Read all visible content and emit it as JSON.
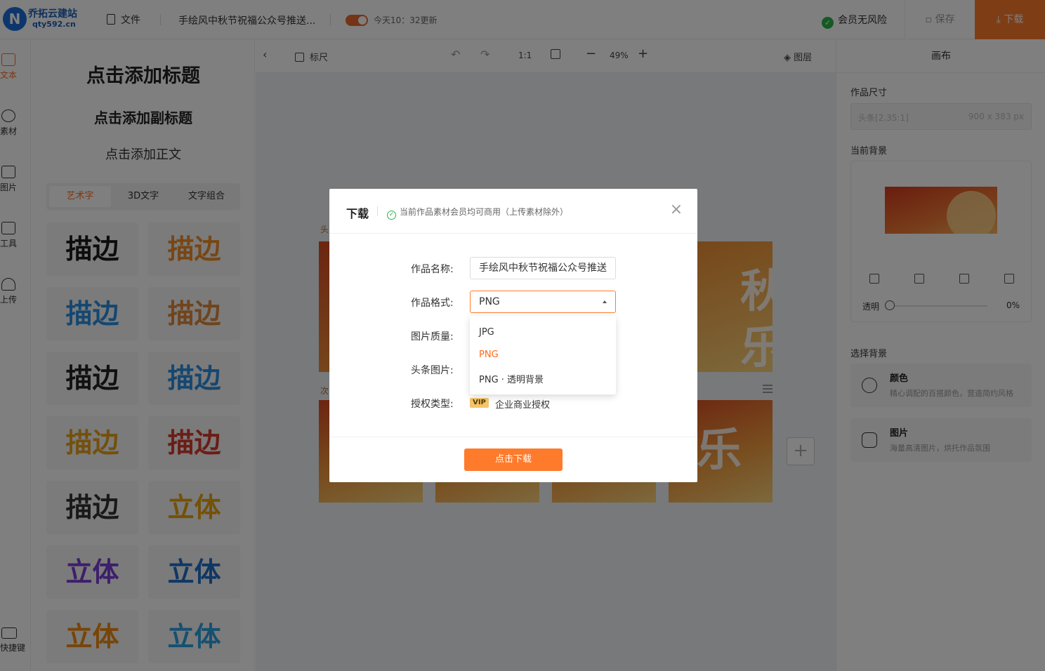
{
  "topbar": {
    "brand_name": "乔拓云建站",
    "brand_domain": "qty592.cn",
    "logo_letter": "N",
    "file_menu": "文件",
    "doc_title": "手绘风中秋节祝福公众号推送...",
    "update_status": "今天10：32更新",
    "vip_status": "会员无风险",
    "save_label": "保存",
    "download_label": "下载"
  },
  "rail": {
    "items": [
      {
        "label": "文本",
        "icon": "text-icon"
      },
      {
        "label": "素材",
        "icon": "material-icon"
      },
      {
        "label": "图片",
        "icon": "image-icon"
      },
      {
        "label": "工具",
        "icon": "toolbox-icon"
      },
      {
        "label": "上传",
        "icon": "upload-cloud-icon"
      }
    ],
    "shortcut_label": "快捷键"
  },
  "textpanel": {
    "add_title": "点击添加标题",
    "add_subtitle": "点击添加副标题",
    "add_body": "点击添加正文",
    "tabs": [
      "艺术字",
      "3D文字",
      "文字组合"
    ],
    "tiles": [
      "描边",
      "描边",
      "描边",
      "描边",
      "描边",
      "描边",
      "描边",
      "描边",
      "描边",
      "立体",
      "立体",
      "立体",
      "立体",
      "立体"
    ],
    "tile_colors": [
      "#1a1a1a",
      "#f08c28",
      "#2a8fe0",
      "#e0883a",
      "#222222",
      "#2a8fe0",
      "#e7a11a",
      "#d63a2a",
      "#333333",
      "#e8a210",
      "#7b3fd6",
      "#1f6fc8",
      "#ef8a12",
      "#2aa0e0"
    ]
  },
  "canvas_toolbar": {
    "ruler_label": "标尺",
    "ratio_label": "1:1",
    "zoom": "49%",
    "layers_label": "图层"
  },
  "canvas": {
    "label_top": "头",
    "label_bottom": "次",
    "glyph_1": "秋",
    "glyph_2": "乐",
    "glyph_3": "乐"
  },
  "rightpanel": {
    "header": "画布",
    "size_label": "作品尺寸",
    "size_name": "头条[2.35:1]",
    "size_dims": "900 x 383 px",
    "bg_label": "当前背景",
    "opacity_label": "透明",
    "opacity_value": "0%",
    "choose_label": "选择背景",
    "choices": [
      {
        "title": "颜色",
        "desc": "精心调配的百搭颜色，营造简约风格"
      },
      {
        "title": "图片",
        "desc": "海量高清图片，烘托作品氛围"
      }
    ]
  },
  "modal": {
    "title": "下载",
    "notice": "当前作品素材会员均可商用（上传素材除外）",
    "close": "×",
    "name_label": "作品名称:",
    "name_value": "手绘风中秋节祝福公众号推送",
    "format_label": "作品格式:",
    "format_value": "PNG",
    "quality_label": "图片质量:",
    "cover_label": "头条图片:",
    "license_label": "授权类型:",
    "vip_tag": "VIP",
    "license_value": "企业商业授权",
    "format_options": [
      "JPG",
      "PNG",
      "PNG · 透明背景"
    ],
    "download_button": "点击下载"
  },
  "colors": {
    "accent": "#ff7b2c",
    "success": "#2bb34a"
  }
}
